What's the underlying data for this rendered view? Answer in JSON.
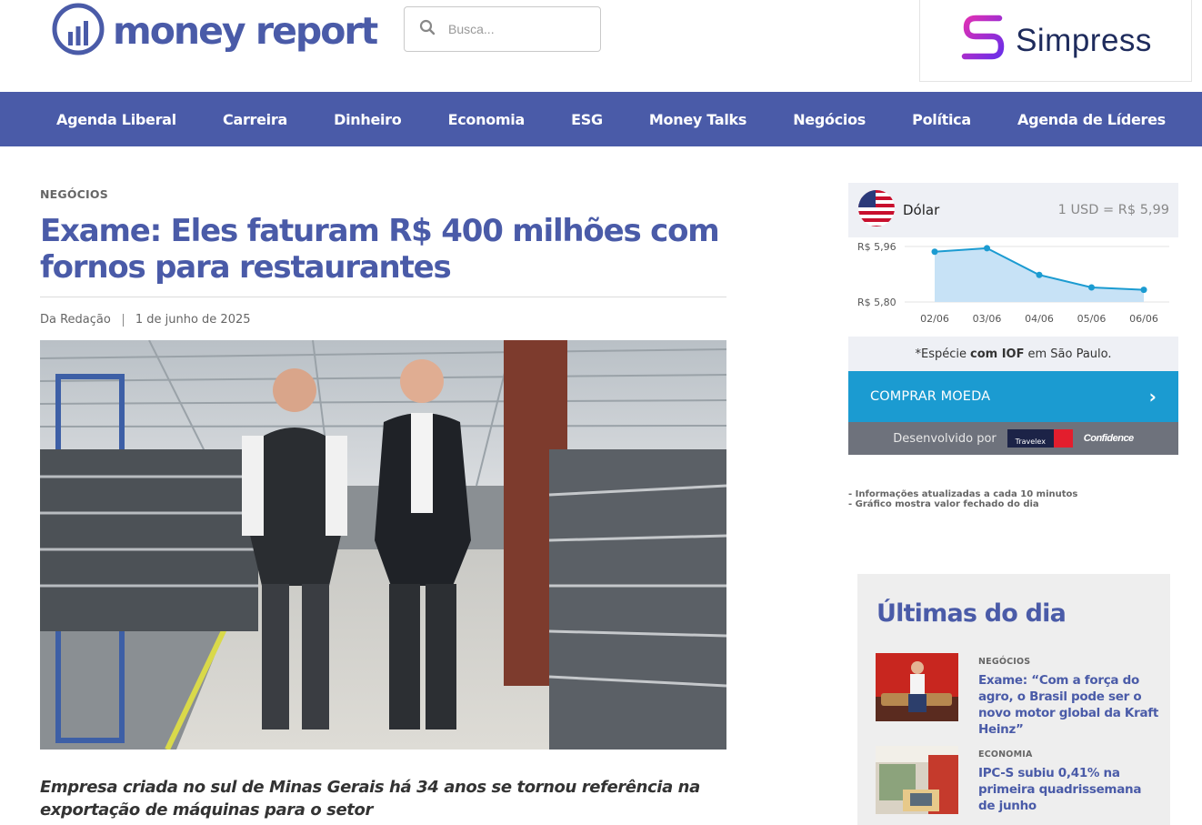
{
  "brand": {
    "name": "money report"
  },
  "search": {
    "placeholder": "Busca..."
  },
  "ad": {
    "text": "Simpress"
  },
  "nav": {
    "items": [
      "Agenda Liberal",
      "Carreira",
      "Dinheiro",
      "Economia",
      "ESG",
      "Money Talks",
      "Negócios",
      "Política",
      "Agenda de Líderes"
    ]
  },
  "article": {
    "category": "NEGÓCIOS",
    "title": "Exame: Eles faturam R$ 400 milhões com fornos para restaurantes",
    "author": "Da Redação",
    "date": "1 de junho de 2025",
    "lead": "Empresa criada no sul de Minas Gerais há 34 anos se tornou referência na exportação de máquinas para o setor"
  },
  "currency": {
    "name": "Dólar",
    "rate": "1 USD = R$ 5,99",
    "note_pre": "*Espécie",
    "note_bold": "com IOF",
    "note_post": "em São Paulo.",
    "buy_label": "COMPRAR MOEDA",
    "dev_label": "Desenvolvido por",
    "partner_a": "Travelex",
    "partner_b": "Confidence",
    "info": [
      "- Informações atualizadas a cada 10 minutos",
      "- Gráfico mostra valor fechado do dia"
    ]
  },
  "chart_data": {
    "type": "area",
    "x": [
      "02/06",
      "03/06",
      "04/06",
      "05/06",
      "06/06"
    ],
    "values": [
      5.945,
      5.955,
      5.878,
      5.842,
      5.835
    ],
    "ytick_labels": [
      "R$ 5,96",
      "R$ 5,80"
    ],
    "ylim": [
      5.8,
      5.96
    ],
    "color": "#1b9bd1",
    "fill": "#c7e2f6",
    "grid": true
  },
  "latest": {
    "title": "Últimas do dia",
    "items": [
      {
        "category": "NEGÓCIOS",
        "title": "Exame: “Com a força do agro, o Brasil pode ser o novo motor global da Kraft Heinz”"
      },
      {
        "category": "ECONOMIA",
        "title": "IPC-S subiu 0,41% na primeira quadrissemana de junho"
      }
    ]
  },
  "colors": {
    "brand": "#4a5ba8",
    "accent": "#1b9bd1"
  }
}
